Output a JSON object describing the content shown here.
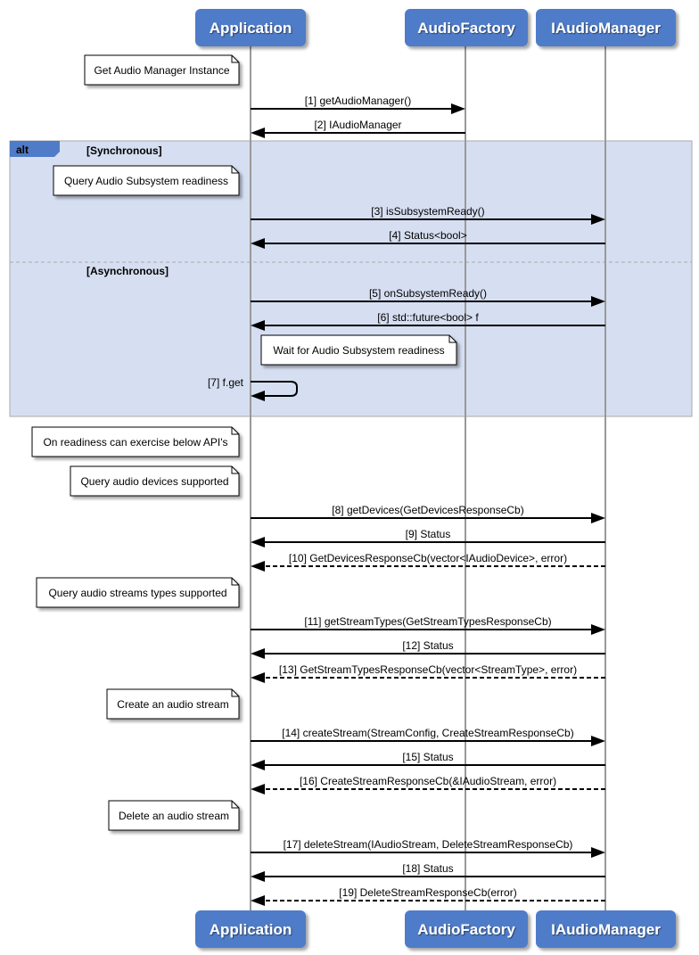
{
  "participants": [
    {
      "name": "Application"
    },
    {
      "name": "AudioFactory"
    },
    {
      "name": "IAudioManager"
    }
  ],
  "colors": {
    "participant": "#4f7bc8",
    "alt_fill": "#d6dff1",
    "alt_tab": "#4f7bc8",
    "lifeline": "#999999"
  },
  "alt": {
    "label": "alt",
    "sections": [
      {
        "guard": "[Synchronous]"
      },
      {
        "guard": "[Asynchronous]"
      }
    ]
  },
  "notes": [
    {
      "text": "Get Audio Manager Instance"
    },
    {
      "text": "Query Audio Subsystem readiness"
    },
    {
      "text": "Wait for Audio Subsystem readiness"
    },
    {
      "text": "On readiness can exercise below API's"
    },
    {
      "text": "Query audio devices supported"
    },
    {
      "text": "Query audio streams types supported"
    },
    {
      "text": "Create an audio stream"
    },
    {
      "text": "Delete an audio stream"
    }
  ],
  "messages": [
    {
      "label": "[1] getAudioManager()",
      "from": "Application",
      "to": "AudioFactory",
      "style": "solid"
    },
    {
      "label": "[2] IAudioManager",
      "from": "AudioFactory",
      "to": "Application",
      "style": "solid"
    },
    {
      "label": "[3] isSubsystemReady()",
      "from": "Application",
      "to": "IAudioManager",
      "style": "solid"
    },
    {
      "label": "[4] Status<bool>",
      "from": "IAudioManager",
      "to": "Application",
      "style": "solid"
    },
    {
      "label": "[5] onSubsystemReady()",
      "from": "Application",
      "to": "IAudioManager",
      "style": "solid"
    },
    {
      "label": "[6] std::future<bool> f",
      "from": "IAudioManager",
      "to": "Application",
      "style": "solid"
    },
    {
      "label": "[7] f.get",
      "from": "Application",
      "to": "Application",
      "style": "solid"
    },
    {
      "label": "[8] getDevices(GetDevicesResponseCb)",
      "from": "Application",
      "to": "IAudioManager",
      "style": "solid"
    },
    {
      "label": "[9] Status",
      "from": "IAudioManager",
      "to": "Application",
      "style": "solid"
    },
    {
      "label": "[10] GetDevicesResponseCb(vector<IAudioDevice>, error)",
      "from": "IAudioManager",
      "to": "Application",
      "style": "dashed"
    },
    {
      "label": "[11] getStreamTypes(GetStreamTypesResponseCb)",
      "from": "Application",
      "to": "IAudioManager",
      "style": "solid"
    },
    {
      "label": "[12] Status",
      "from": "IAudioManager",
      "to": "Application",
      "style": "solid"
    },
    {
      "label": "[13] GetStreamTypesResponseCb(vector<StreamType>, error)",
      "from": "IAudioManager",
      "to": "Application",
      "style": "dashed"
    },
    {
      "label": "[14] createStream(StreamConfig, CreateStreamResponseCb)",
      "from": "Application",
      "to": "IAudioManager",
      "style": "solid"
    },
    {
      "label": "[15] Status",
      "from": "IAudioManager",
      "to": "Application",
      "style": "solid"
    },
    {
      "label": "[16] CreateStreamResponseCb(&IAudioStream, error)",
      "from": "IAudioManager",
      "to": "Application",
      "style": "dashed"
    },
    {
      "label": "[17] deleteStream(IAudioStream, DeleteStreamResponseCb)",
      "from": "Application",
      "to": "IAudioManager",
      "style": "solid"
    },
    {
      "label": "[18] Status",
      "from": "IAudioManager",
      "to": "Application",
      "style": "solid"
    },
    {
      "label": "[19] DeleteStreamResponseCb(error)",
      "from": "IAudioManager",
      "to": "Application",
      "style": "dashed"
    }
  ]
}
